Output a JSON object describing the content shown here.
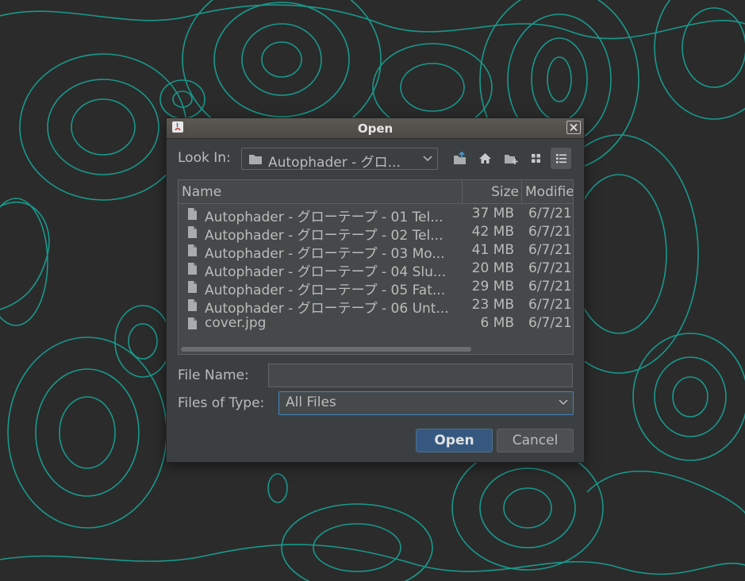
{
  "dialog": {
    "title": "Open",
    "look_in_label": "Look In:",
    "look_in_value": "Autophader - グロ...",
    "toolbar": {
      "up_icon": "folder-up-icon",
      "home_icon": "home-icon",
      "new_folder_icon": "new-folder-icon",
      "list_view_icon": "list-view-icon",
      "details_view_icon": "details-view-icon"
    },
    "columns": {
      "name": "Name",
      "size": "Size",
      "modified": "Modifie"
    },
    "files": [
      {
        "name": "Autophader - グローテープ - 01 Tel...",
        "size": "37 MB",
        "modified": "6/7/21"
      },
      {
        "name": "Autophader - グローテープ - 02 Tel...",
        "size": "42 MB",
        "modified": "6/7/21"
      },
      {
        "name": "Autophader - グローテープ - 03 Mo...",
        "size": "41 MB",
        "modified": "6/7/21"
      },
      {
        "name": "Autophader - グローテープ - 04 Slu...",
        "size": "20 MB",
        "modified": "6/7/21"
      },
      {
        "name": "Autophader - グローテープ - 05 Fat...",
        "size": "29 MB",
        "modified": "6/7/21"
      },
      {
        "name": "Autophader - グローテープ - 06 Unt...",
        "size": "23 MB",
        "modified": "6/7/21"
      },
      {
        "name": "cover.jpg",
        "size": "6 MB",
        "modified": "6/7/21"
      }
    ],
    "file_name_label": "File Name:",
    "file_name_value": "",
    "files_of_type_label": "Files of Type:",
    "files_of_type_value": "All Files",
    "open_button": "Open",
    "cancel_button": "Cancel"
  },
  "colors": {
    "background": "#2b2b2b",
    "contour_lines": "#17a596",
    "dialog_bg": "#3c3f41",
    "accent": "#365880"
  }
}
